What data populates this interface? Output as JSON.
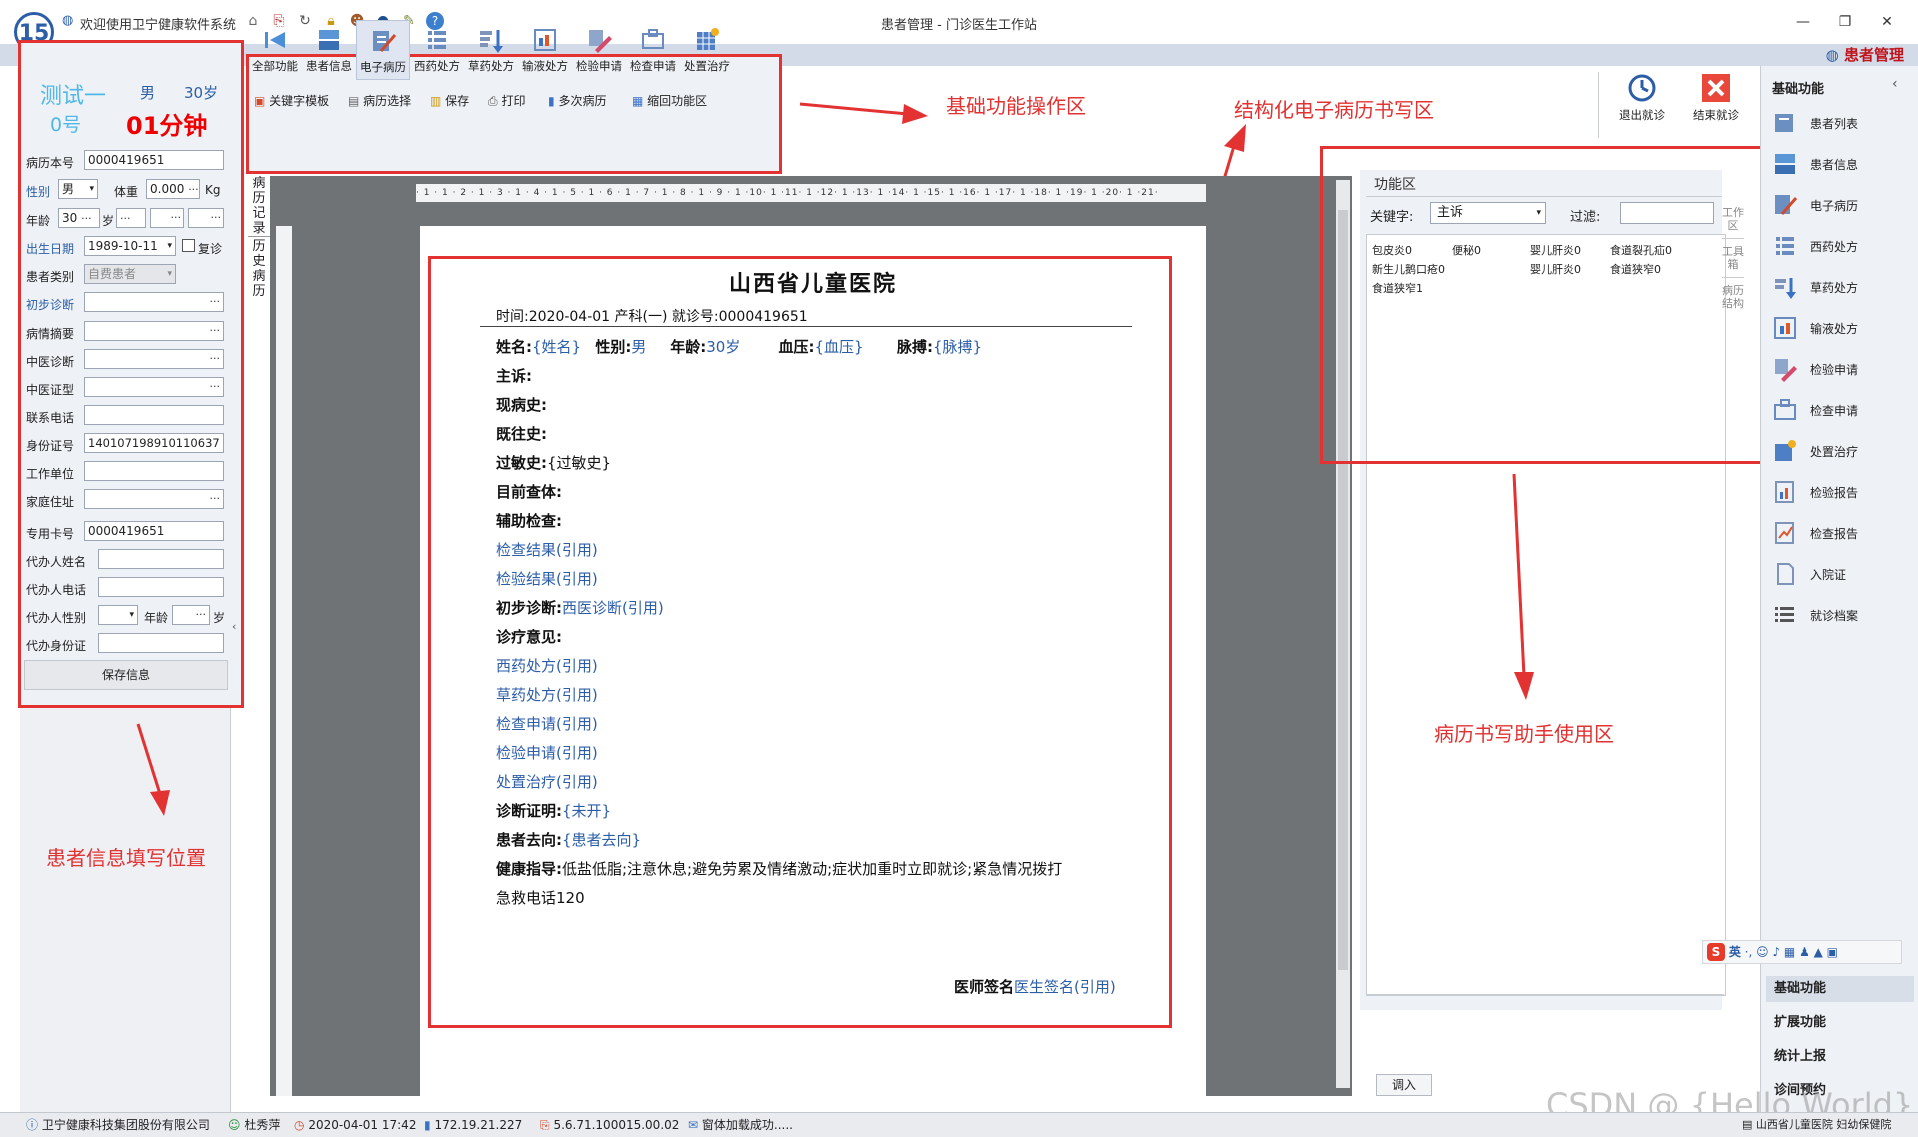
{
  "titlebar": {
    "welcome": "欢迎使用卫宁健康软件系统",
    "title": "患者管理 - 门诊医生工作站",
    "logo_text": "1"
  },
  "band": {
    "module": "患者管理"
  },
  "patient": {
    "name": "测试一",
    "sex": "男",
    "age": "30岁",
    "number": "0号",
    "timer": "01分钟"
  },
  "form": {
    "record_no_label": "病历本号",
    "record_no": "0000419651",
    "sex_label": "性别",
    "sex": "男",
    "weight_label": "体重",
    "weight": "0.000",
    "weight_unit": "Kg",
    "age_label": "年龄",
    "age": "30",
    "age_unit": "岁",
    "birth_label": "出生日期",
    "birth": "1989-10-11",
    "revisit_label": "复诊",
    "category_label": "患者类别",
    "category": "自费患者",
    "prelim_label": "初步诊断",
    "summary_label": "病情摘要",
    "tcm_diag_label": "中医诊断",
    "tcm_type_label": "中医证型",
    "phone_label": "联系电话",
    "id_label": "身份证号",
    "id": "140107198910110637",
    "work_label": "工作单位",
    "address_label": "家庭住址",
    "card_label": "专用卡号",
    "card": "0000419651",
    "agent_name_label": "代办人姓名",
    "agent_phone_label": "代办人电话",
    "agent_sex_label": "代办人性别",
    "agent_age_label": "年龄",
    "agent_age_unit": "岁",
    "agent_id_label": "代办身份证",
    "save_label": "保存信息"
  },
  "toolbar": {
    "buttons": [
      "全部功能",
      "患者信息",
      "电子病历",
      "西药处方",
      "草药处方",
      "输液处方",
      "检验申请",
      "检查申请",
      "处置治疗"
    ],
    "sub": [
      "关键字模板",
      "病历选择",
      "保存",
      "打印",
      "多次病历",
      "缩回功能区"
    ],
    "exit_label": "退出就诊",
    "end_label": "结束就诊"
  },
  "side_tabs": [
    "病历记录",
    "历史病历"
  ],
  "annotations": {
    "basic": "基础功能操作区",
    "structured": "结构化电子病历书写区",
    "patient_info": "患者信息填写位置",
    "assistant": "病历书写助手使用区"
  },
  "ruler_text": "· 1 · 1 · 2 · 1 · 3 · 1 · 4 · 1 · 5 · 1 · 6 · 1 · 7 · 1 · 8 · 1 · 9 · 1 ·10· 1 ·11· 1 ·12· 1 ·13· 1 ·14· 1 ·15· 1 ·16· 1 ·17· 1 ·18· 1 ·19· 1 ·20· 1 ·21·",
  "document": {
    "hospital": "山西省儿童医院",
    "header": "时间:2020-04-01   产科(一)  就诊号:0000419651",
    "name_label": "姓名:",
    "name_val": "{姓名}",
    "sex_label": "性别:",
    "sex_val": "男",
    "age_label": "年龄:",
    "age_val": "30岁",
    "bp_label": "血压:",
    "bp_val": "{血压}",
    "pulse_label": "脉搏:",
    "pulse_val": "{脉搏}",
    "complaint": "主诉:",
    "present": "现病史:",
    "past": "既往史:",
    "allergy_label": "过敏史:",
    "allergy_val": "{过敏史}",
    "exam": "目前查体:",
    "aux": "辅助检查:",
    "exam_result": "检查结果(引用)",
    "lab_result": "检验结果(引用)",
    "prelim_label": "初步诊断:",
    "prelim_val": "西医诊断(引用)",
    "advice": "诊疗意见:",
    "western_rx": "西药处方(引用)",
    "herbal_rx": "草药处方(引用)",
    "exam_req": "检查申请(引用)",
    "lab_req": "检验申请(引用)",
    "treatment": "处置治疗(引用)",
    "cert_label": "诊断证明:",
    "cert_val": "{未开}",
    "dest_label": "患者去向:",
    "dest_val": "{患者去向}",
    "health_label": "健康指导:",
    "health_val": "低盐低脂;注意休息;避免劳累及情绪激动;症状加重时立即就诊;紧急情况拨打",
    "health_val2": "急救电话120",
    "sign_label": "医师签名",
    "sign_val": "医生签名(引用)"
  },
  "func": {
    "title": "功能区",
    "keyword_label": "关键字:",
    "keyword_value": "主诉",
    "filter_label": "过滤:",
    "words": [
      "包皮炎0",
      "便秘0",
      "婴儿肝炎0",
      "食道裂孔疝0",
      "新生儿鹅口疮0",
      "婴儿肝炎0",
      "食道狭窄0",
      "食道狭窄1"
    ],
    "vtabs": [
      "工作区",
      "工具箱",
      "病历结构"
    ],
    "import_label": "调入"
  },
  "right": {
    "header": "基础功能",
    "items": [
      "患者列表",
      "患者信息",
      "电子病历",
      "西药处方",
      "草药处方",
      "输液处方",
      "检验申请",
      "检查申请",
      "处置治疗",
      "检验报告",
      "检查报告",
      "入院证",
      "就诊档案"
    ],
    "categories": [
      "基础功能",
      "扩展功能",
      "统计上报",
      "诊间预约"
    ],
    "ime": "英"
  },
  "status": {
    "company": "卫宁健康科技集团股份有限公司",
    "user": "杜秀萍",
    "datetime": "2020-04-01 17:42",
    "ip": "172.19.21.227",
    "version": "5.6.71.100015.00.02",
    "message": "窗体加载成功.....",
    "org": "山西省儿童医院 妇幼保健院"
  },
  "watermark": "CSDN @ {Hello World}",
  "colors": {
    "accent": "#2c5ea8",
    "alert": "#e23232",
    "timer": "#e00000",
    "name": "#4fb8e6"
  }
}
